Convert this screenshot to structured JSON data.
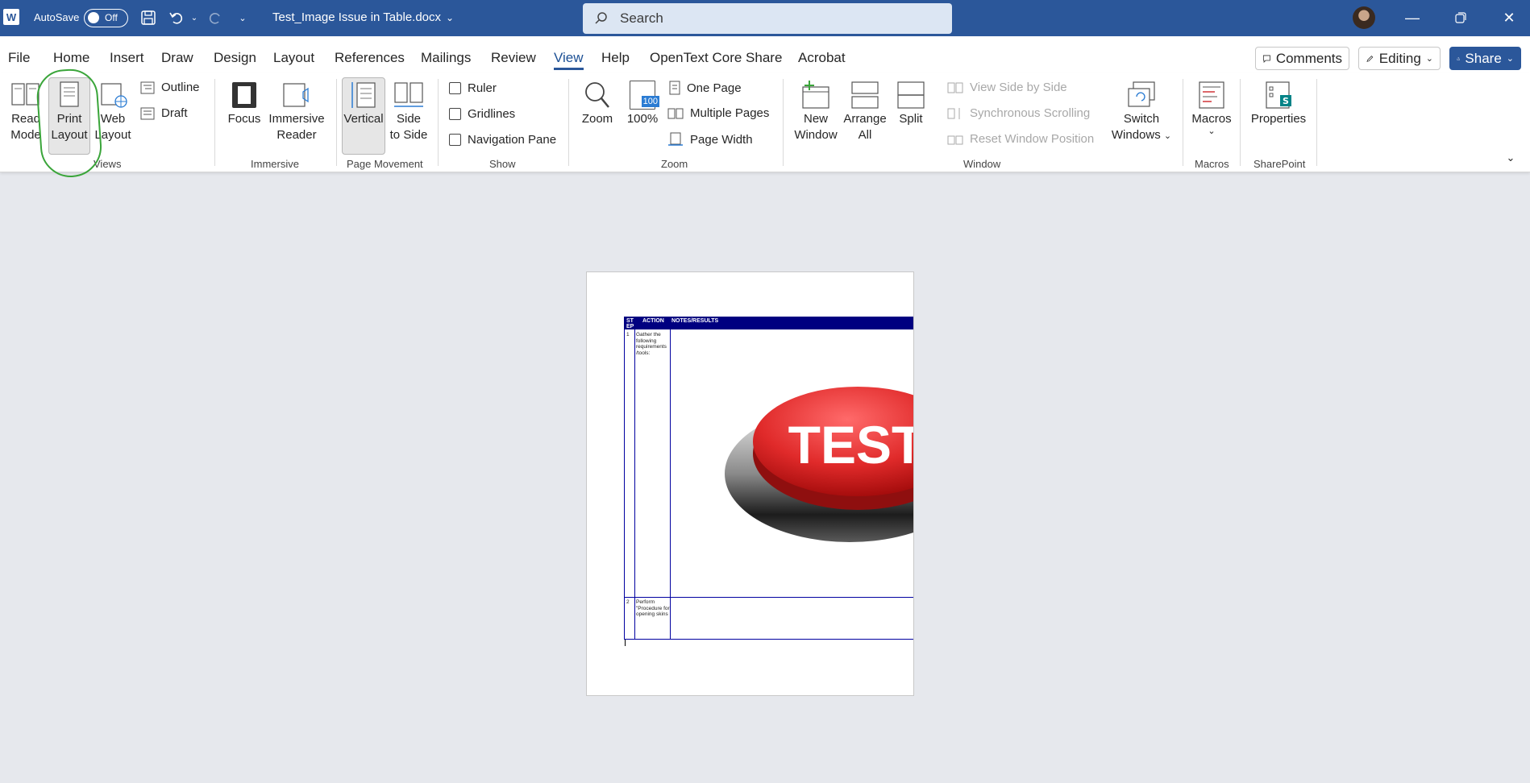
{
  "titlebar": {
    "app_logo": "W",
    "autosave_label": "AutoSave",
    "autosave_state": "Off",
    "doc_title": "Test_Image Issue in Table.docx",
    "search_placeholder": "Search"
  },
  "tabs": [
    "File",
    "Home",
    "Insert",
    "Draw",
    "Design",
    "Layout",
    "References",
    "Mailings",
    "Review",
    "View",
    "Help",
    "OpenText Core Share",
    "Acrobat"
  ],
  "active_tab": "View",
  "tab_buttons": {
    "comments": "Comments",
    "editing": "Editing",
    "share": "Share"
  },
  "ribbon": {
    "views": {
      "read_mode": [
        "Read",
        "Mode"
      ],
      "print_layout": [
        "Print",
        "Layout"
      ],
      "web_layout": [
        "Web",
        "Layout"
      ],
      "outline": "Outline",
      "draft": "Draft",
      "label": "Views"
    },
    "immersive": {
      "focus": "Focus",
      "immersive_reader": [
        "Immersive",
        "Reader"
      ],
      "label": "Immersive"
    },
    "page_movement": {
      "vertical": "Vertical",
      "side_to_side": [
        "Side",
        "to Side"
      ],
      "label": "Page Movement"
    },
    "show": {
      "ruler": "Ruler",
      "gridlines": "Gridlines",
      "navigation_pane": "Navigation Pane",
      "label": "Show"
    },
    "zoom": {
      "zoom": "Zoom",
      "hundred": "100%",
      "hundred_icon": "100",
      "one_page": "One Page",
      "multiple_pages": "Multiple Pages",
      "page_width": "Page Width",
      "label": "Zoom"
    },
    "window": {
      "new_window": [
        "New",
        "Window"
      ],
      "arrange_all": [
        "Arrange",
        "All"
      ],
      "split": "Split",
      "view_side_by_side": "View Side by Side",
      "synchronous_scrolling": "Synchronous Scrolling",
      "reset_window_position": "Reset Window Position",
      "switch_windows": [
        "Switch",
        "Windows"
      ],
      "label": "Window"
    },
    "macros": {
      "macros": "Macros",
      "label": "Macros"
    },
    "sharepoint": {
      "properties": "Properties",
      "label": "SharePoint"
    }
  },
  "document": {
    "table_headers": [
      "ST EP",
      "ACTION",
      "NOTES/RESULTS"
    ],
    "rows": [
      {
        "step": "1",
        "action": "Gather the following requirements /tools:"
      },
      {
        "step": "2",
        "action": "Perform \"Procedure for opening skins"
      }
    ],
    "image_text": "TEST"
  },
  "colors": {
    "brand": "#2b579a",
    "table_header": "#000080",
    "annotation": "#3aa53a"
  }
}
